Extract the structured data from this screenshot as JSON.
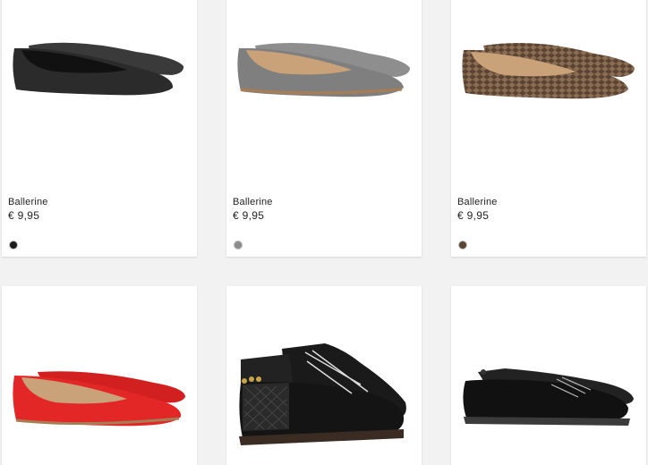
{
  "products": [
    {
      "name": "Ballerine",
      "price": "€ 9,95",
      "swatch_color": "#1a1a1a",
      "image": "black-ballerina-flat"
    },
    {
      "name": "Ballerine",
      "price": "€ 9,95",
      "swatch_color": "#8c8c8c",
      "image": "grey-ballerina-flat"
    },
    {
      "name": "Ballerine",
      "price": "€ 9,95",
      "swatch_color": "#5a4535",
      "image": "snakeskin-ballerina-flat"
    },
    {
      "image": "red-ballerina-flat"
    },
    {
      "image": "black-quilted-high-top-sneaker"
    },
    {
      "image": "black-canvas-slip-on-sneaker"
    }
  ]
}
